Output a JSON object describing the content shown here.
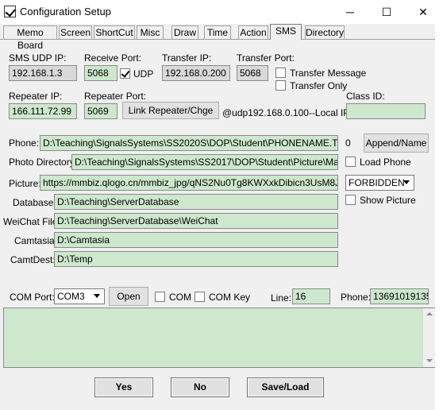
{
  "window": {
    "title": "Configuration Setup"
  },
  "tabs": [
    "Memo Board",
    "Screen",
    "ShortCut",
    "Misc",
    "Draw",
    "Time",
    "Action",
    "SMS",
    "Directory"
  ],
  "sms": {
    "udp_ip_label": "SMS UDP IP:",
    "udp_ip": "192.168.1.3",
    "receive_port_label": "Receive Port:",
    "receive_port": "5068",
    "udp_label": "UDP",
    "udp_checked": true,
    "transfer_ip_label": "Transfer IP:",
    "transfer_ip": "192.168.0.200",
    "transfer_port_label": "Transfer Port:",
    "transfer_port": "5068",
    "transfer_message_label": "Transfer Message",
    "transfer_only_label": "Transfer Only",
    "repeater_ip_label": "Repeater IP:",
    "repeater_ip": "166.111.72.99",
    "repeater_port_label": "Repeater Port:",
    "repeater_port": "5069",
    "link_button": "Link Repeater/Chge",
    "local_ip_text": "@udp192.168.0.100--Local IP",
    "class_id_label": "Class ID:",
    "class_id": ""
  },
  "paths": {
    "phone_label": "Phone:",
    "phone": "D:\\Teaching\\SignalsSystems\\SS2020S\\DOP\\Student\\PHONENAME.TXT",
    "phone_count": "0",
    "append_button": "Append/Name",
    "photo_dir_label": "Photo Directory:",
    "photo_dir": "D:\\Teaching\\SignalsSystems\\SS2017\\DOP\\Student\\Picture\\Marked",
    "load_phone_label": "Load Phone",
    "picture_label": "Picture:",
    "picture": "https://mmbiz.qlogo.cn/mmbiz_jpg/qNS2Nu0Tg8KWXxkDibicn3UsM8Jic5lia1I",
    "picture_mode": "FORBIDDEN",
    "show_picture_label": "Show Picture",
    "database_label": "Database:",
    "database": "D:\\Teaching\\ServerDatabase",
    "weichat_label": "WeiChat File:",
    "weichat": "D:\\Teaching\\ServerDatabase\\WeiChat",
    "camtasia_label": "Camtasia:",
    "camtasia": "D:\\Camtasia",
    "camtdest_label": "CamtDest:",
    "camtdest": "D:\\Temp"
  },
  "com": {
    "port_label": "COM Port:",
    "port": "COM3",
    "open_button": "Open",
    "com_label": "COM",
    "com_key_label": "COM Key",
    "line_label": "Line:",
    "line": "16",
    "phone_label": "Phone:",
    "phone": "13691019135"
  },
  "footer": {
    "yes": "Yes",
    "no": "No",
    "save_load": "Save/Load"
  }
}
